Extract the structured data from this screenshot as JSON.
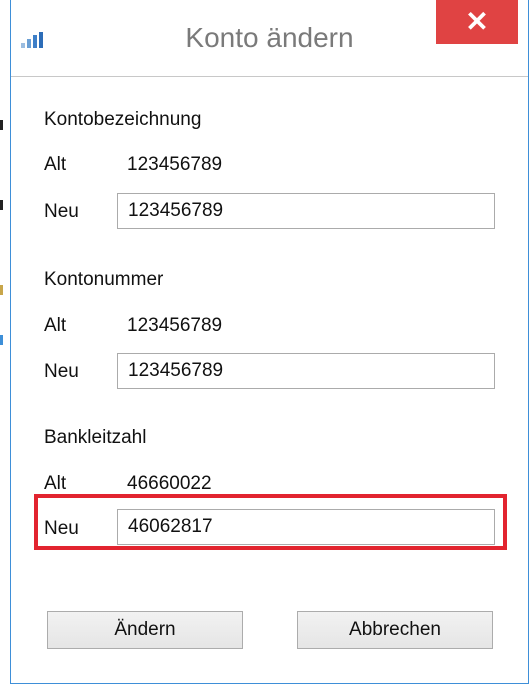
{
  "window": {
    "title": "Konto ändern",
    "close_glyph": "✕",
    "icon": "bar-chart-icon",
    "accent_color": "#3e8fd8",
    "close_color": "#e04343"
  },
  "sections": {
    "kontobezeichnung": {
      "heading": "Kontobezeichnung",
      "alt_label": "Alt",
      "alt_value": "123456789",
      "neu_label": "Neu",
      "neu_value": "123456789"
    },
    "kontonummer": {
      "heading": "Kontonummer",
      "alt_label": "Alt",
      "alt_value": "123456789",
      "neu_label": "Neu",
      "neu_value": "123456789"
    },
    "bankleitzahl": {
      "heading": "Bankleitzahl",
      "alt_label": "Alt",
      "alt_value": "46660022",
      "neu_label": "Neu",
      "neu_value": "46062817",
      "highlight_color": "#e2242f"
    }
  },
  "buttons": {
    "aendern": "Ändern",
    "abbrechen": "Abbrechen"
  }
}
